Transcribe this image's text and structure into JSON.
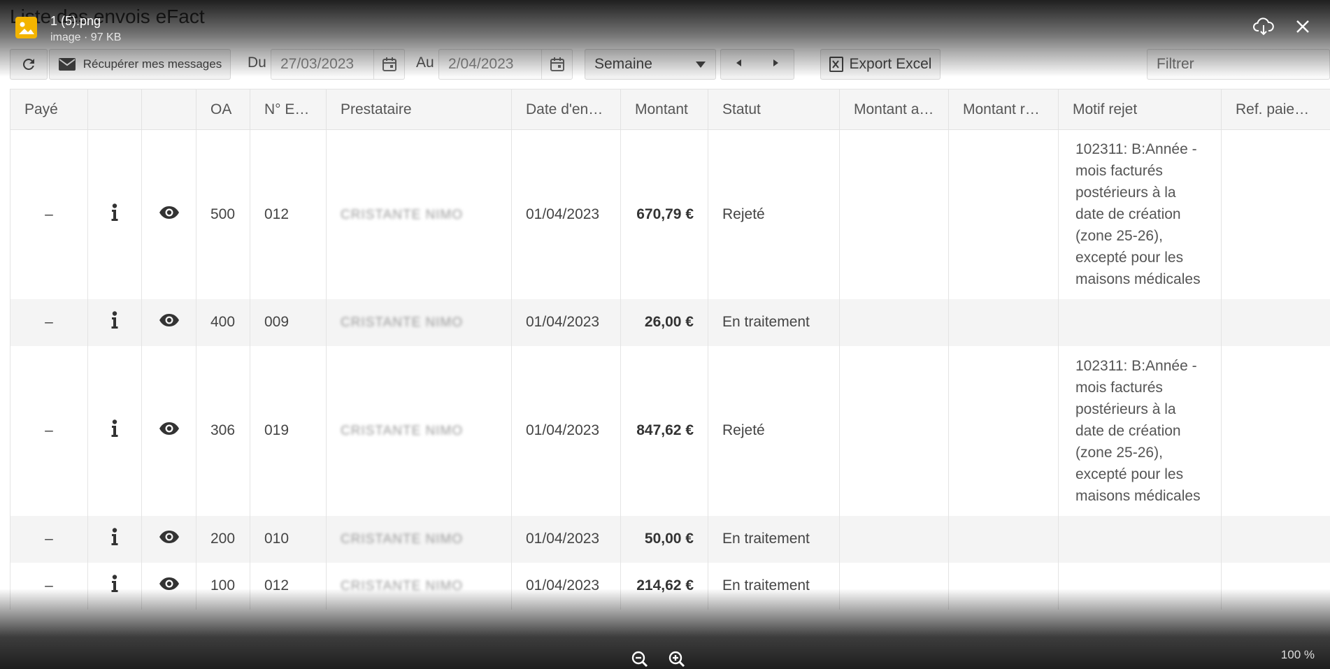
{
  "page": {
    "title": "Liste des envois eFact"
  },
  "toolbar": {
    "refresh_icon": "refresh-icon",
    "fetch_label": "Récupérer mes messages",
    "from_label": "Du",
    "from_value": "27/03/2023",
    "to_label": "Au",
    "to_value": "2/04/2023",
    "period_selected": "Semaine",
    "export_label": "Export Excel",
    "filter_placeholder": "Filtrer"
  },
  "table": {
    "columns": [
      "Payé",
      "",
      "",
      "OA",
      "N° Env...",
      "Prestataire",
      "Date d'envoi",
      "Montant",
      "Statut",
      "Montant ac...",
      "Montant re...",
      "Motif rejet",
      "Ref. paiement"
    ],
    "rows": [
      {
        "paid": "–",
        "oa": "500",
        "env": "012",
        "provider": "CRISTANTE NIMO",
        "date": "01/04/2023",
        "amount": "670,79 €",
        "status": "Rejeté",
        "accepted": "",
        "refused": "",
        "motif": "102311: B:Année - mois facturés postérieurs à la date de création (zone 25-26), excepté pour les maisons médicales",
        "ref": ""
      },
      {
        "paid": "–",
        "oa": "400",
        "env": "009",
        "provider": "CRISTANTE NIMO",
        "date": "01/04/2023",
        "amount": "26,00 €",
        "status": "En traitement",
        "accepted": "",
        "refused": "",
        "motif": "",
        "ref": ""
      },
      {
        "paid": "–",
        "oa": "306",
        "env": "019",
        "provider": "CRISTANTE NIMO",
        "date": "01/04/2023",
        "amount": "847,62 €",
        "status": "Rejeté",
        "accepted": "",
        "refused": "",
        "motif": "102311: B:Année - mois facturés postérieurs à la date de création (zone 25-26), excepté pour les maisons médicales",
        "ref": ""
      },
      {
        "paid": "–",
        "oa": "200",
        "env": "010",
        "provider": "CRISTANTE NIMO",
        "date": "01/04/2023",
        "amount": "50,00 €",
        "status": "En traitement",
        "accepted": "",
        "refused": "",
        "motif": "",
        "ref": ""
      },
      {
        "paid": "–",
        "oa": "100",
        "env": "012",
        "provider": "CRISTANTE NIMO",
        "date": "01/04/2023",
        "amount": "214,62 €",
        "status": "En traitement",
        "accepted": "",
        "refused": "",
        "motif": "",
        "ref": ""
      }
    ]
  },
  "viewer": {
    "file_name": "1 (5).png",
    "file_meta": "image · 97 KB",
    "zoom_level": "100 %"
  },
  "colors": {
    "file_icon": "#f3b400"
  }
}
